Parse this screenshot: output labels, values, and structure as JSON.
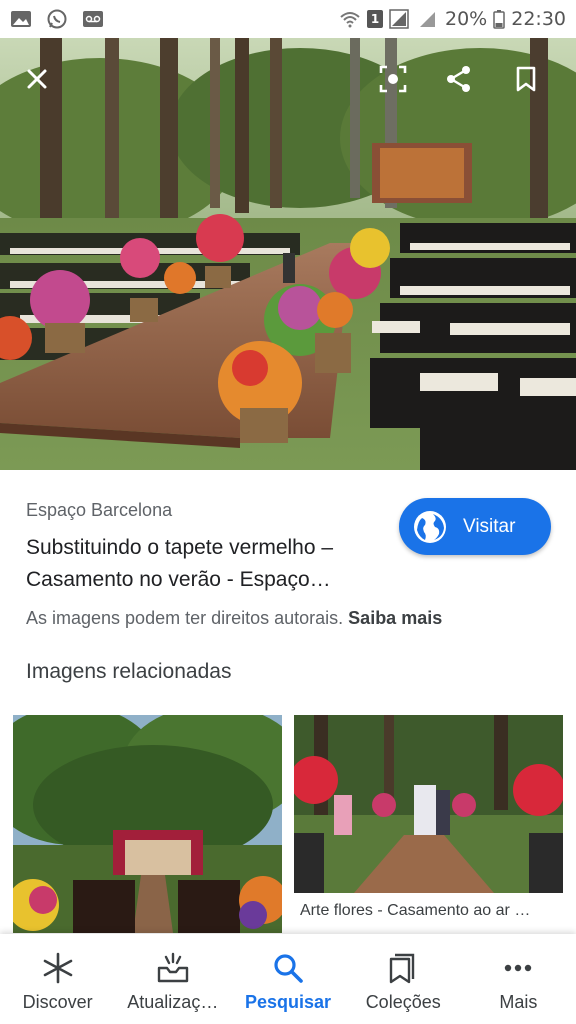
{
  "status_bar": {
    "battery": "20%",
    "time": "22:30",
    "sim": "1",
    "left_icons": [
      "gallery-icon",
      "whatsapp-icon",
      "voicemail-icon"
    ]
  },
  "hero": {
    "actions": [
      "close-icon",
      "lens-icon",
      "share-icon",
      "bookmark-icon"
    ]
  },
  "result": {
    "source": "Espaço Barcelona",
    "title_line1": "Substituindo o tapete vermelho –",
    "title_line2": "Casamento no verão - Espaço…",
    "visit_label": "Visitar",
    "copyright_text": "As imagens podem ter direitos autorais.",
    "copyright_link": "Saiba mais"
  },
  "related": {
    "heading": "Imagens relacionadas",
    "items": [
      {
        "caption": ""
      },
      {
        "caption": "Arte flores - Casamento ao ar …",
        "sub": ""
      }
    ]
  },
  "bottom_nav": {
    "items": [
      {
        "label": "Discover",
        "icon": "asterisk-icon"
      },
      {
        "label": "Atualizaç…",
        "icon": "updates-icon"
      },
      {
        "label": "Pesquisar",
        "icon": "search-icon"
      },
      {
        "label": "Coleções",
        "icon": "collections-icon"
      },
      {
        "label": "Mais",
        "icon": "more-icon"
      }
    ],
    "active_index": 2
  },
  "colors": {
    "accent": "#1a73e8",
    "text_primary": "#202124",
    "text_secondary": "#5f6368"
  }
}
